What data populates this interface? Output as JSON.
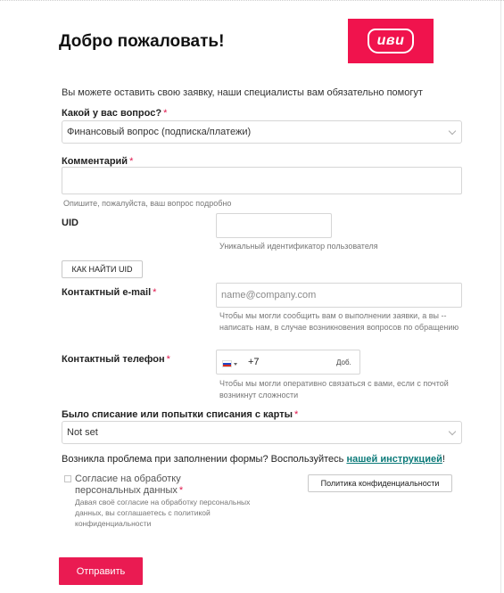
{
  "title": "Добро пожаловать!",
  "logo_text": "иви",
  "intro": "Вы можете оставить свою заявку, наши специалисты вам обязательно помогут",
  "question": {
    "label": "Какой у вас вопрос?",
    "required_mark": "*",
    "selected": "Финансовый вопрос (подписка/платежи)"
  },
  "comment": {
    "label": "Комментарий",
    "required_mark": "*",
    "help": "Опишите, пожалуйста, ваш вопрос подробно"
  },
  "uid": {
    "label": "UID",
    "help": "Уникальный идентификатор пользователя",
    "find_button": "КАК НАЙТИ UID"
  },
  "email": {
    "label": "Контактный e-mail",
    "required_mark": "*",
    "placeholder": "name@company.com",
    "help": "Чтобы мы могли сообщить вам о выполнении заявки, а вы -- написать нам, в случае возникновения вопросов по обращению"
  },
  "phone": {
    "label": "Контактный телефон",
    "required_mark": "*",
    "prefix": "+7",
    "ext_label": "Доб.",
    "help": "Чтобы мы могли оперативно связаться с вами, если с почтой возникнут сложности"
  },
  "chargeback": {
    "label": "Было списание или попытки списания с карты",
    "required_mark": "*",
    "selected": "Not set"
  },
  "problem_note": {
    "text": "Возникла проблема при заполнении формы? Воспользуйтесь ",
    "link": "нашей инструкцией",
    "suffix": "!"
  },
  "consent": {
    "label_line1": "Согласие на обработку",
    "label_line2": "персональных данных",
    "required_mark": "*",
    "help": "Давая своё согласие на обработку персональных данных, вы соглашаетесь с политикой конфиденциальности",
    "policy_button": "Политика конфиденциальности"
  },
  "submit_label": "Отправить",
  "colors": {
    "brand": "#f0134d",
    "submit": "#ea1b52",
    "required": "#e0174c",
    "link": "#0b7a79"
  }
}
